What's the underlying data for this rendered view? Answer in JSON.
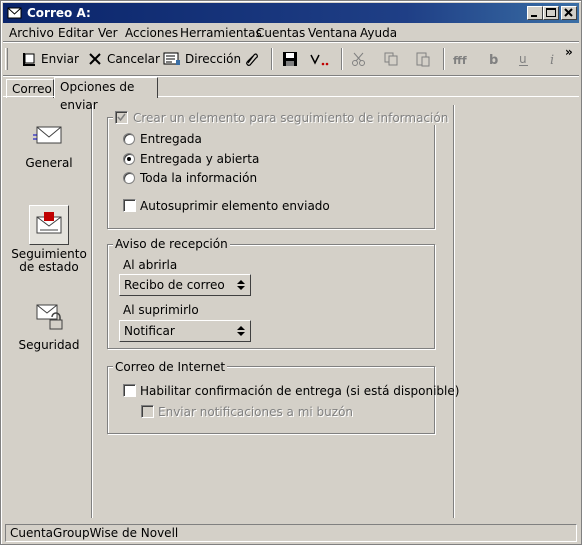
{
  "window": {
    "title": "Correo A:"
  },
  "menu": [
    "Archivo",
    "Editar",
    "Ver",
    "Acciones",
    "Herramientas",
    "Cuentas",
    "Ventana",
    "Ayuda"
  ],
  "toolbar": {
    "send": "Enviar",
    "cancel": "Cancelar",
    "address": "Dirección",
    "overflow": "»"
  },
  "tabs": [
    "Correo",
    "Opciones de enviar"
  ],
  "sidebar": [
    {
      "label": "General",
      "icon": "envelope-icon"
    },
    {
      "label": "Seguimiento de estado",
      "icon": "status-tracking-icon"
    },
    {
      "label": "Seguridad",
      "icon": "security-lock-icon"
    }
  ],
  "tracking": {
    "create_item": "Crear un elemento para seguimiento de información",
    "options": [
      "Entregada",
      "Entregada y abierta",
      "Toda la información"
    ],
    "selected": "Entregada y abierta",
    "auto_delete": "Autosuprimir elemento enviado"
  },
  "receipt": {
    "title": "Aviso de recepción",
    "on_open_label": "Al abrirla",
    "on_open_value": "Recibo de correo",
    "on_delete_label": "Al suprimirlo",
    "on_delete_value": "Notificar"
  },
  "internet": {
    "title": "Correo de Internet",
    "enable_delivery": "Habilitar confirmación de entrega (si está disponible)",
    "send_notifications": "Enviar notificaciones a mi buzón"
  },
  "status": {
    "text": "CuentaGroupWise de Novell"
  }
}
